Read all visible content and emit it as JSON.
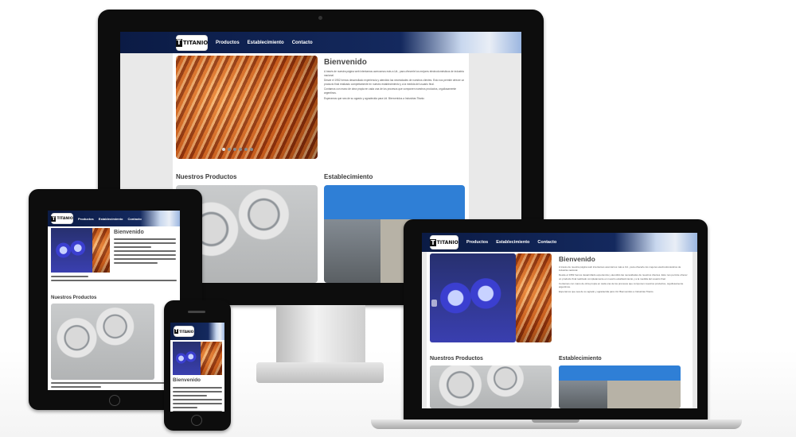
{
  "site": {
    "logo_text": "TITANIO",
    "nav": [
      "Productos",
      "Establecimiento",
      "Contacto"
    ],
    "welcome_title": "Bienvenido",
    "welcome_p1": "A través de nuestra página web intentamos acercarnos más a Ud., para ofrecerle los mejores electrodomésticos de industria nacional.",
    "welcome_p2": "Desde el 1952 hemos desarrollado experiencia y atendido las necesidades de nuestros clientes. Esto nos permite ofrecer un producto final realizado completamente en nuestro establecimiento y a la medida del usuario final.",
    "welcome_p3": "Contamos con mano de obra propia en cada una de los procesos que componen nuestros productos, orgullosamente argentinos.",
    "welcome_p4": "Esperamos que sea de su agrado y agradecida para Ud. Bienvenidos a Industrias Titanio",
    "section_products": "Nuestros Productos",
    "section_establishment": "Establecimiento"
  },
  "colors": {
    "nav_dark": "#0b1b45",
    "device_frame": "#111111",
    "heading": "#3a3a3a"
  }
}
